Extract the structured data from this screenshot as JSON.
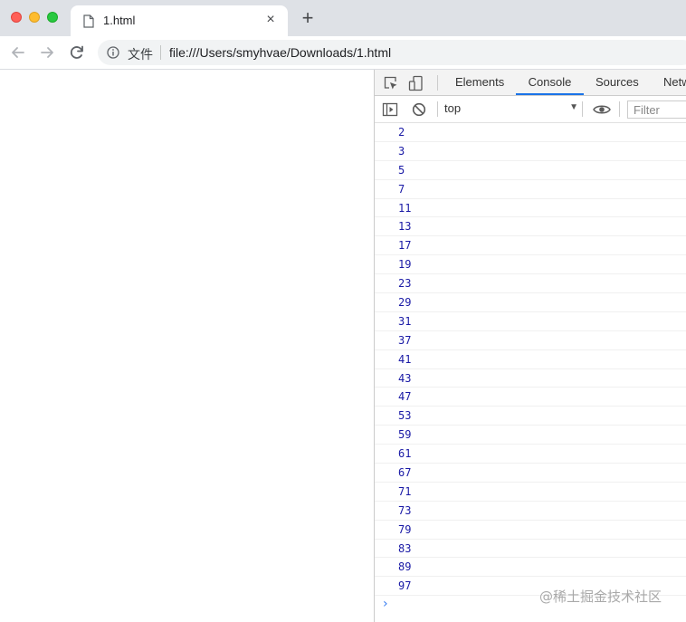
{
  "tab": {
    "title": "1.html",
    "close_glyph": "×",
    "new_tab_glyph": "+"
  },
  "toolbar": {
    "site_label": "文件",
    "url": "file:///Users/smyhvae/Downloads/1.html"
  },
  "devtools": {
    "tabs": [
      "Elements",
      "Console",
      "Sources",
      "Netw"
    ],
    "active_tab": "Console",
    "context": "top",
    "filter_placeholder": "Filter",
    "log": [
      "2",
      "3",
      "5",
      "7",
      "11",
      "13",
      "17",
      "19",
      "23",
      "29",
      "31",
      "37",
      "41",
      "43",
      "47",
      "53",
      "59",
      "61",
      "67",
      "71",
      "73",
      "79",
      "83",
      "89",
      "97"
    ],
    "prompt": "›"
  },
  "watermark": "@稀土掘金技术社区",
  "colors": {
    "accent": "#1a73e8",
    "log_number": "#1a1aa6"
  },
  "icons": [
    "file-icon",
    "back-arrow-icon",
    "forward-arrow-icon",
    "reload-icon",
    "info-icon",
    "inspect-element-icon",
    "device-toggle-icon",
    "sidebar-toggle-icon",
    "clear-console-icon",
    "eye-icon"
  ]
}
